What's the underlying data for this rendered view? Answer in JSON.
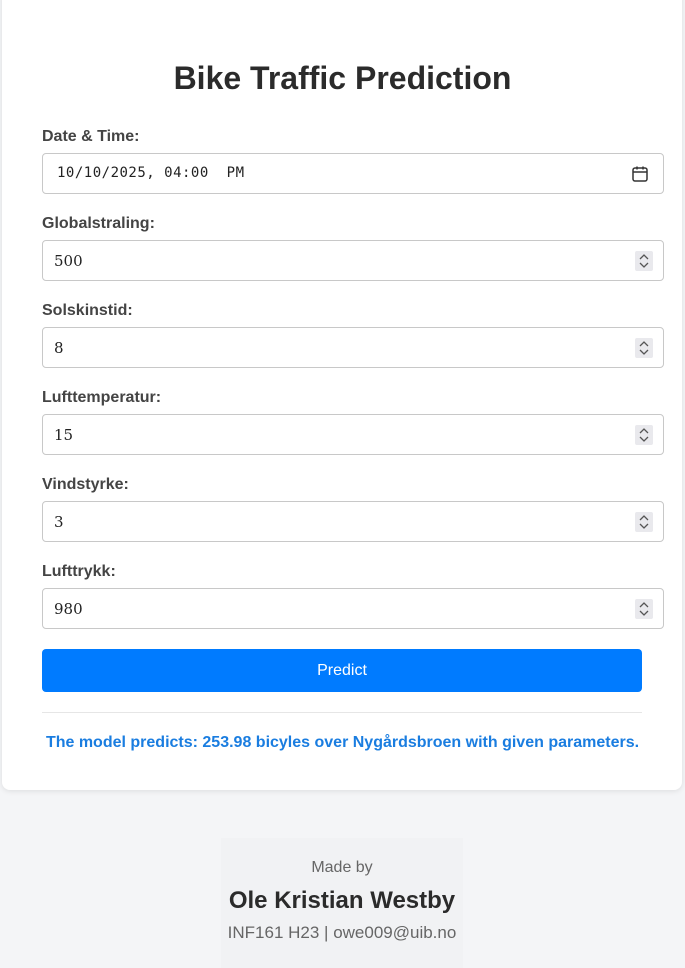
{
  "title": "Bike Traffic Prediction",
  "form": {
    "datetime": {
      "label": "Date & Time:",
      "value": "10/10/2025, 04:00  PM"
    },
    "globalstraling": {
      "label": "Globalstraling:",
      "value": "500"
    },
    "solskinstid": {
      "label": "Solskinstid:",
      "value": "8"
    },
    "lufttemperatur": {
      "label": "Lufttemperatur:",
      "value": "15"
    },
    "vindstyrke": {
      "label": "Vindstyrke:",
      "value": "3"
    },
    "lufttrykk": {
      "label": "Lufttrykk:",
      "value": "980"
    }
  },
  "predict_button": "Predict",
  "result_text": "The model predicts: 253.98 bicyles over Nygårdsbroen with given parameters.",
  "footer": {
    "made_by": "Made by",
    "author": "Ole Kristian Westby",
    "course": "INF161 H23 | owe009@uib.no"
  },
  "colors": {
    "accent": "#007bff",
    "result": "#1a7de0",
    "background": "#f4f5f7",
    "card": "#ffffff"
  },
  "icons": {
    "datetime": "calendar-icon",
    "number_fields": "spinner-icon"
  }
}
